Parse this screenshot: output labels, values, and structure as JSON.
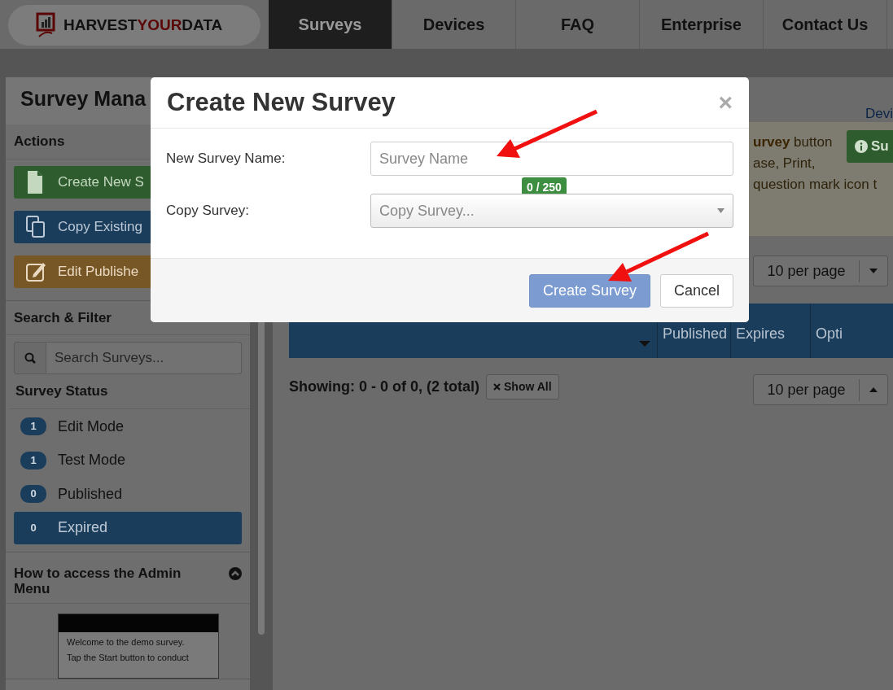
{
  "navbar": {
    "brand": {
      "before": "HARVEST",
      "highlight": "YOUR",
      "after": "DATA"
    },
    "tabs": [
      {
        "label": "Surveys",
        "selected": true
      },
      {
        "label": "Devices",
        "selected": false
      },
      {
        "label": "FAQ",
        "selected": false
      },
      {
        "label": "Enterprise",
        "selected": false
      },
      {
        "label": "Contact Us",
        "selected": false
      }
    ]
  },
  "sidebar": {
    "title": "Survey Mana",
    "actions": {
      "heading": "Actions",
      "buttons": [
        {
          "kind": "create",
          "label": "Create New S"
        },
        {
          "kind": "copy",
          "label": "Copy Existing"
        },
        {
          "kind": "edit",
          "label": "Edit Publishe"
        }
      ]
    },
    "search_filter": {
      "heading": "Search & Filter",
      "search": {
        "placeholder": "Search Surveys..."
      },
      "status_heading": "Survey Status",
      "statuses": [
        {
          "count": "1",
          "label": "Edit Mode",
          "selected": false
        },
        {
          "count": "1",
          "label": "Test Mode",
          "selected": false
        },
        {
          "count": "0",
          "label": "Published",
          "selected": false
        },
        {
          "count": "0",
          "label": "Expired",
          "selected": true
        }
      ]
    },
    "admin_help": {
      "heading": "How to access the Admin Menu",
      "expanded": true,
      "preview_lines": [
        "Welcome to the demo survey.",
        "Tap the Start button to conduct"
      ]
    }
  },
  "main": {
    "top_link": "Devi",
    "alert": {
      "lines": [
        "**urvey** button",
        "ase, Print,",
        "question mark icon t"
      ]
    },
    "alert_button": "Su",
    "per_page_top": "10 per page",
    "table": {
      "columns": [
        "Published",
        "Expires",
        "Opti"
      ]
    },
    "showing": "Showing: 0 - 0 of 0, (2 total)",
    "show_all": "Show All",
    "per_page_bottom": "10 per page"
  },
  "modal": {
    "title": "Create New Survey",
    "close": "×",
    "fields": [
      {
        "kind": "text",
        "label": "New Survey Name:",
        "placeholder": "Survey Name",
        "counter": "0 / 250"
      },
      {
        "kind": "select",
        "label": "Copy Survey:",
        "placeholder": "Copy Survey..."
      }
    ],
    "buttons": [
      {
        "kind": "primary",
        "label": "Create Survey"
      },
      {
        "kind": "secondary",
        "label": "Cancel"
      }
    ]
  }
}
